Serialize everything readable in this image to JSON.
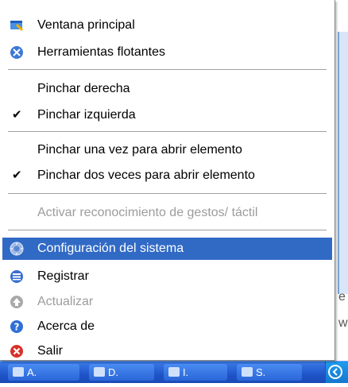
{
  "menu": {
    "items": [
      {
        "label": "Ventana principal",
        "icon": "main-window-icon"
      },
      {
        "label": "Herramientas flotantes",
        "icon": "floating-tools-icon"
      },
      {
        "label": "Pinchar derecha",
        "checked": false
      },
      {
        "label": "Pinchar izquierda",
        "checked": true
      },
      {
        "label": "Pinchar una vez para abrir elemento",
        "checked": false
      },
      {
        "label": "Pinchar dos veces para abrir elemento",
        "checked": true
      },
      {
        "label": "Activar reconocimiento de gestos/ táctil",
        "disabled": true
      },
      {
        "label": "Configuración del sistema",
        "icon": "system-settings-icon",
        "selected": true
      },
      {
        "label": "Registrar",
        "icon": "register-icon"
      },
      {
        "label": "Actualizar",
        "icon": "update-icon",
        "disabled": true
      },
      {
        "label": "Acerca de",
        "icon": "about-icon"
      },
      {
        "label": "Salir",
        "icon": "exit-icon"
      }
    ],
    "check_glyph": "✔"
  },
  "background": {
    "partial_text_1": "e",
    "partial_text_2": "w"
  },
  "taskbar": {
    "buttons": [
      "A.",
      "D.",
      "I.",
      "S."
    ]
  },
  "colors": {
    "selection": "#316ac5",
    "taskbar": "#245edb",
    "disabled_text": "#9c9c9c"
  }
}
